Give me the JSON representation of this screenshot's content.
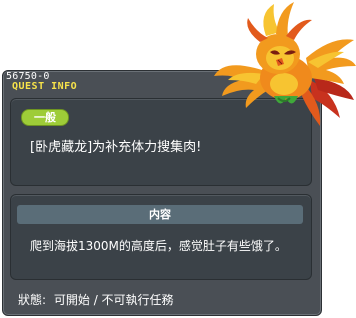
{
  "quest": {
    "id": "56750-0",
    "header_label": "QUEST INFO",
    "type_badge": "一般",
    "title": "[卧虎藏龙]为补充体力搜集肉!",
    "section_header": "内容",
    "description": "爬到海拔1300M的高度后，感觉肚子有些饿了。",
    "status_label": "狀態:",
    "status_value": "可開始 / 不可執行任務"
  },
  "mascot": {
    "icon": "phoenix-mascot-icon"
  },
  "colors": {
    "panel_bg": "#4a4f55",
    "box_bg": "#3b4248",
    "badge_green": "#9ecc38",
    "header_yellow": "#f7e34a",
    "section_header_bg": "#5a6d78"
  }
}
